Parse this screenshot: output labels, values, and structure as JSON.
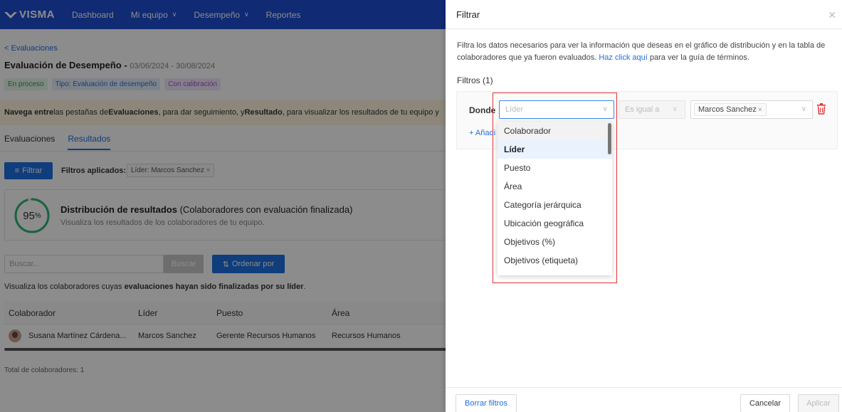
{
  "nav": {
    "logo": "VISMA",
    "items": [
      {
        "label": "Dashboard",
        "has_chevron": false
      },
      {
        "label": "Mi equipo",
        "has_chevron": true
      },
      {
        "label": "Desempeño",
        "has_chevron": true
      },
      {
        "label": "Reportes",
        "has_chevron": false
      }
    ]
  },
  "page": {
    "back_link": "< Evaluaciones",
    "title": "Evaluación de Desempeño - ",
    "dates": "03/06/2024 - 30/08/2024",
    "badges": [
      "En proceso",
      "Tipo: Evaluación de desempeño",
      "Con calibración"
    ],
    "banner": {
      "p1": "Navega entre",
      "p2": " las pestañas de ",
      "p3": "Evaluaciones",
      "p4": ", para dar seguimiento, y ",
      "p5": "Resultado",
      "p6": ", para visualizar los resultados de tu equipo y"
    },
    "tabs": [
      "Evaluaciones",
      "Resultados"
    ],
    "filter_button": "Filtrar",
    "filters_applied_label": "Filtros aplicados:",
    "applied_chip": "Líder: Marcos Sanchez",
    "distribution": {
      "percent": "95",
      "percent_symbol": "%",
      "progress": 0.95,
      "title_bold": "Distribución de resultados",
      "title_rest": " (Colaboradores con evaluación finalizada)",
      "subtitle": "Visualiza los resultados de los colaboradores de tu equipo."
    },
    "search": {
      "placeholder": "Buscar...",
      "button": "Buscar"
    },
    "sort_button": "Ordenar por",
    "table_caption_pre": "Visualiza los colaboradores cuyas ",
    "table_caption_bold": "evaluaciones hayan sido finalizadas por su líder",
    "table_caption_post": ".",
    "table": {
      "headers": [
        "Colaborador",
        "Líder",
        "Puesto",
        "Área"
      ],
      "rows": [
        [
          "Susana Martínez Cárdena...",
          "Marcos Sanchez",
          "Gerente Recursos Humanos",
          "Recursos Humanos"
        ]
      ]
    },
    "total": "Total de colaboradores: 1"
  },
  "drawer": {
    "title": "Filtrar",
    "description": "Filtra los datos necesarios para ver la información que deseas en el gráfico de distribución y en la tabla de colaboradores que ya fueron evaluados. ",
    "link_text": "Haz click aquí",
    "description_post": " para ver la guía de términos.",
    "filters_count": "Filtros (1)",
    "where_label": "Donde",
    "field_select": {
      "placeholder": "Líder"
    },
    "operator_select": {
      "value": "Es igual a"
    },
    "value_tag": "Marcos Sanchez",
    "add_filter": "+ Añadi",
    "dropdown_options": [
      {
        "label": "Colaborador",
        "state": "hover"
      },
      {
        "label": "Líder",
        "state": "selected"
      },
      {
        "label": "Puesto",
        "state": ""
      },
      {
        "label": "Área",
        "state": ""
      },
      {
        "label": "Categoría jerárquica",
        "state": ""
      },
      {
        "label": "Ubicación geográfica",
        "state": ""
      },
      {
        "label": "Objetivos (%)",
        "state": ""
      },
      {
        "label": "Objetivos (etiqueta)",
        "state": ""
      }
    ],
    "footer": {
      "clear": "Borrar filtros",
      "cancel": "Cancelar",
      "apply": "Aplicar"
    }
  },
  "colors": {
    "primary": "#1e4dd2",
    "accent": "#1e6fe0",
    "highlight": "#e5333b",
    "ring": "#2bb673"
  }
}
